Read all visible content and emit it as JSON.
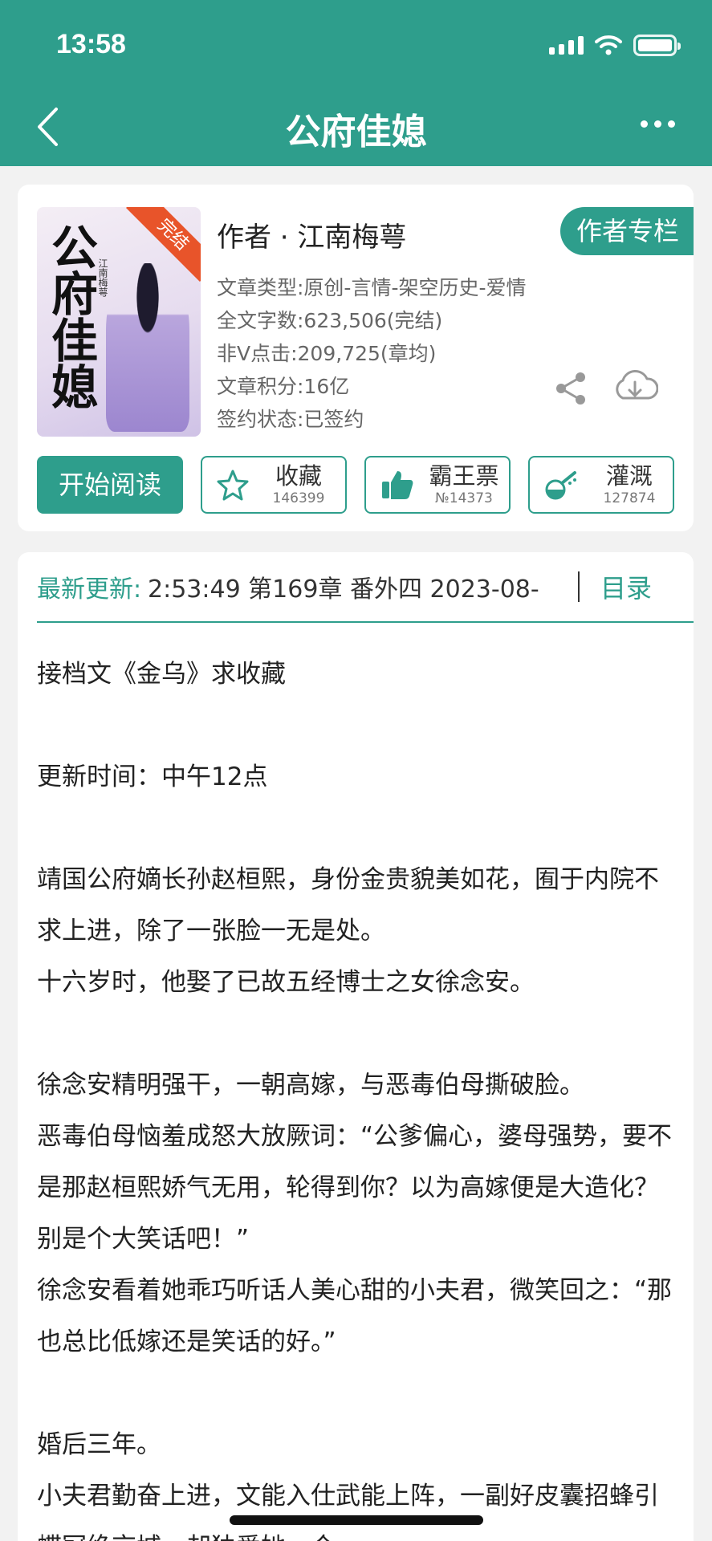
{
  "status_bar": {
    "time": "13:58"
  },
  "header": {
    "title": "公府佳媳"
  },
  "book": {
    "cover": {
      "badge": "完结",
      "title": "公府佳媳",
      "author": "江南梅萼"
    },
    "author_line": "作者 · 江南梅萼",
    "author_column_label": "作者专栏",
    "meta": [
      "文章类型:原创-言情-架空历史-爱情",
      "全文字数:623,506(完结)",
      "非Ⅴ点击:209,725(章均)",
      "文章积分:16亿",
      "签约状态:已签约"
    ]
  },
  "actions": {
    "read_label": "开始阅读",
    "favorite": {
      "label": "收藏",
      "count": "146399"
    },
    "vote": {
      "label": "霸王票",
      "count": "№14373"
    },
    "water": {
      "label": "灌溉",
      "count": "127874"
    }
  },
  "update": {
    "label": "最新更新:",
    "text": "2:53:49   第169章 番外四 2023-08-",
    "toc_label": "目录"
  },
  "intro_text": "接档文《金乌》求收藏\n\n更新时间：中午12点\n\n靖国公府嫡长孙赵桓熙，身份金贵貌美如花，囿于内院不求上进，除了一张脸一无是处。\n十六岁时，他娶了已故五经博士之女徐念安。\n\n徐念安精明强干，一朝高嫁，与恶毒伯母撕破脸。\n恶毒伯母恼羞成怒大放厥词：“公爹偏心，婆母强势，要不是那赵桓熙娇气无用，轮得到你？以为高嫁便是大造化？别是个大笑话吧！”\n徐念安看着她乖巧听话人美心甜的小夫君，微笑回之：“那也总比低嫁还是笑话的好。”\n\n婚后三年。\n小夫君勤奋上进，文能入仕武能上阵，一副好皮囊招蜂引蝶冠绝京城，却独爱她一个。",
  "colors": {
    "accent": "#2e9e8c",
    "ribbon": "#e8542a"
  },
  "icons": {
    "back": "chevron-left-icon",
    "more": "more-dots-icon",
    "share": "share-icon",
    "download": "cloud-download-icon",
    "favorite": "star-icon",
    "vote": "thumbs-up-icon",
    "water": "watering-icon"
  }
}
